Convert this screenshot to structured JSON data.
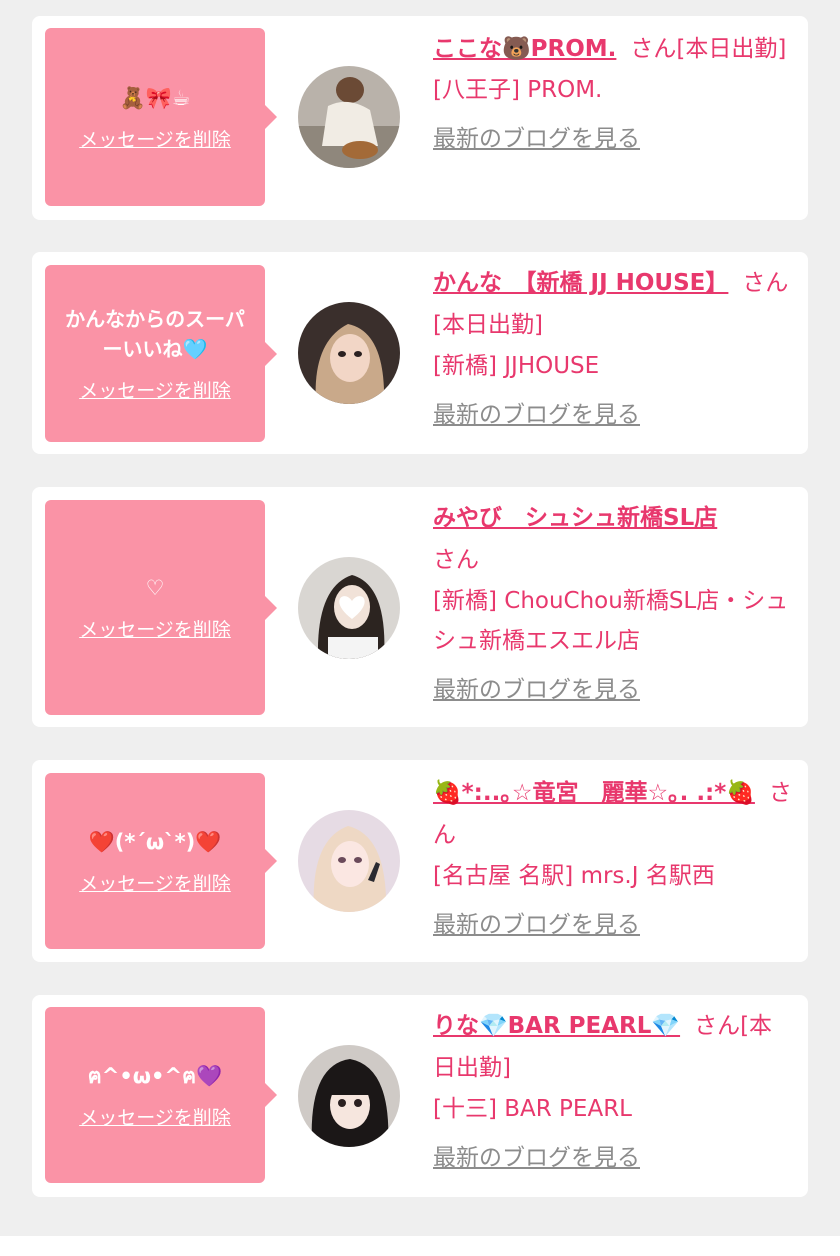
{
  "delete_label": "メッセージを削除",
  "blog_label": "最新のブログを見る",
  "colors": {
    "accent": "#e8386d",
    "bubble": "#fa93a6",
    "muted": "#8c8c8c",
    "background": "#efefef"
  },
  "items": [
    {
      "message": "🧸🎀☕",
      "name": "ここな🐻PROM.",
      "suffix": "さん[本日出勤]",
      "shop": "[八王子] PROM."
    },
    {
      "message": "かんなからのスーパーいいね🩵",
      "name": "かんな　【新橋 JJ HOUSE】",
      "suffix": "さん[本日出勤]",
      "shop": "[新橋] JJHOUSE"
    },
    {
      "message": "♡",
      "name": "みやび　シュシュ新橋SL店",
      "suffix": "さん",
      "shop": "[新橋] ChouChou新橋SL店・シュシュ新橋エスエル店"
    },
    {
      "message": "❤️(*´ω`*)❤️",
      "name": "🍓*:..｡☆竜宮　麗華☆｡. .:*🍓",
      "suffix": "さん",
      "shop": "[名古屋 名駅] mrs.J 名駅西"
    },
    {
      "message": "ฅ^•ω•^ฅ💜",
      "name": "りな💎BAR PEARL💎",
      "suffix": "さん[本日出勤]",
      "shop": "[十三] BAR PEARL"
    }
  ]
}
